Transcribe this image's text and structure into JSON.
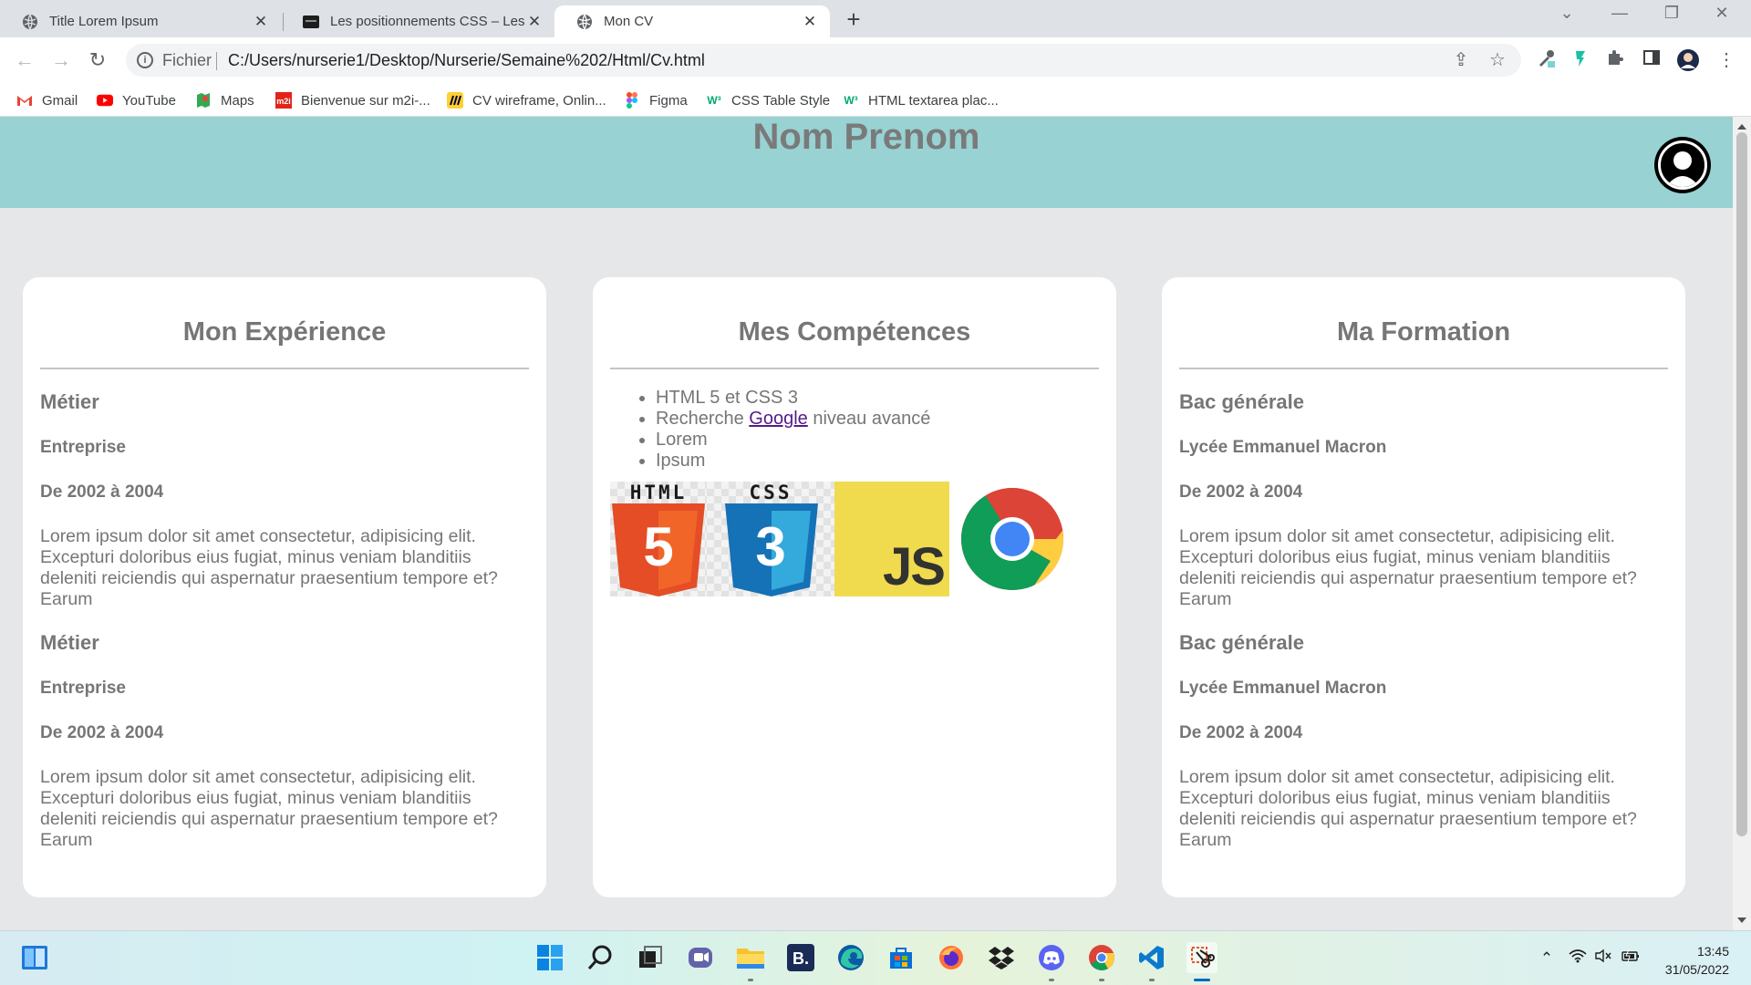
{
  "browser": {
    "tabs": [
      {
        "title": "Title Lorem Ipsum",
        "icon": "globe-icon",
        "active": false
      },
      {
        "title": "Les positionnements CSS – Les D",
        "icon": "site-favicon",
        "active": false
      },
      {
        "title": "Mon CV",
        "icon": "globe-icon",
        "active": true
      }
    ],
    "address": {
      "scheme_label": "Fichier",
      "url": "C:/Users/nurserie1/Desktop/Nurserie/Semaine%202/Html/Cv.html"
    },
    "bookmarks": [
      {
        "label": "Gmail",
        "icon": "gmail-icon",
        "color": "#ea4335"
      },
      {
        "label": "YouTube",
        "icon": "youtube-icon",
        "color": "#ff0000"
      },
      {
        "label": "Maps",
        "icon": "maps-icon",
        "color": "#34a853"
      },
      {
        "label": "Bienvenue sur m2i-...",
        "icon": "m2i-icon",
        "color": "#e2231a"
      },
      {
        "label": "CV wireframe, Onlin...",
        "icon": "miro-icon",
        "color": "#ffd02f"
      },
      {
        "label": "Figma",
        "icon": "figma-icon",
        "color": "#f24e1e"
      },
      {
        "label": "CSS Table Style",
        "icon": "w3schools-icon",
        "color": "#04aa6d"
      },
      {
        "label": "HTML textarea plac...",
        "icon": "w3schools-icon",
        "color": "#04aa6d"
      }
    ]
  },
  "cv": {
    "name": "Nom Prenom",
    "experience": {
      "title": "Mon Expérience",
      "entries": [
        {
          "heading": "Métier",
          "subheading": "Entreprise",
          "period": "De 2002 à 2004",
          "text": "Lorem ipsum dolor sit amet consectetur, adipisicing elit. Excepturi doloribus eius fugiat, minus veniam blanditiis deleniti reiciendis qui aspernatur praesentium tempore et? Earum"
        },
        {
          "heading": "Métier",
          "subheading": "Entreprise",
          "period": "De 2002 à 2004",
          "text": "Lorem ipsum dolor sit amet consectetur, adipisicing elit. Excepturi doloribus eius fugiat, minus veniam blanditiis deleniti reiciendis qui aspernatur praesentium tempore et? Earum"
        }
      ]
    },
    "skills": {
      "title": "Mes Compétences",
      "items": [
        {
          "text": "HTML 5 et CSS 3"
        },
        {
          "before": "Recherche ",
          "link": "Google",
          "after": " niveau avancé"
        },
        {
          "text": "Lorem"
        },
        {
          "text": "Ipsum"
        }
      ],
      "logos": [
        {
          "name": "html5-logo",
          "label": "HTML",
          "numeral": "5"
        },
        {
          "name": "css3-logo",
          "label": "CSS",
          "numeral": "3"
        },
        {
          "name": "javascript-logo",
          "label": "JS"
        },
        {
          "name": "chrome-logo"
        }
      ]
    },
    "education": {
      "title": "Ma Formation",
      "entries": [
        {
          "heading": "Bac générale",
          "subheading": "Lycée Emmanuel Macron",
          "period": "De 2002 à 2004",
          "text": "Lorem ipsum dolor sit amet consectetur, adipisicing elit. Excepturi doloribus eius fugiat, minus veniam blanditiis deleniti reiciendis qui aspernatur praesentium tempore et? Earum"
        },
        {
          "heading": "Bac générale",
          "subheading": "Lycée Emmanuel Macron",
          "period": "De 2002 à 2004",
          "text": "Lorem ipsum dolor sit amet consectetur, adipisicing elit. Excepturi doloribus eius fugiat, minus veniam blanditiis deleniti reiciendis qui aspernatur praesentium tempore et? Earum"
        }
      ]
    }
  },
  "taskbar": {
    "apps": [
      {
        "name": "start-icon"
      },
      {
        "name": "search-icon"
      },
      {
        "name": "task-view-icon"
      },
      {
        "name": "teams-chat-icon"
      },
      {
        "name": "file-explorer-icon"
      },
      {
        "name": "b-app-icon"
      },
      {
        "name": "edge-icon"
      },
      {
        "name": "store-icon"
      },
      {
        "name": "firefox-icon"
      },
      {
        "name": "dropbox-icon"
      },
      {
        "name": "discord-icon"
      },
      {
        "name": "chrome-icon"
      },
      {
        "name": "vscode-icon"
      },
      {
        "name": "snipping-tool-icon"
      }
    ],
    "time": "13:45",
    "date": "31/05/2022"
  }
}
